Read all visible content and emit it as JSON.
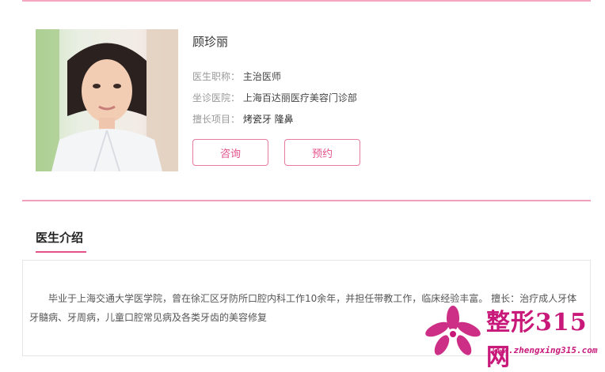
{
  "doctor": {
    "name": "顾珍丽",
    "title_label": "医生职称：",
    "title_value": "主治医师",
    "hospital_label": "坐诊医院：",
    "hospital_value": "上海百达丽医疗美容门诊部",
    "specialty_label": "擅长项目：",
    "specialty_value": "烤瓷牙 隆鼻"
  },
  "actions": {
    "consult_label": "咨询",
    "book_label": "预约"
  },
  "intro": {
    "title": "医生介绍",
    "text": "毕业于上海交通大学医学院，曾在徐汇区牙防所口腔内科工作10余年，并担任带教工作，临床经验丰富。 擅长：治疗成人牙体牙髓病、牙周病，儿童口腔常见病及各类牙齿的美容修复"
  },
  "watermark": {
    "brand": "整形315网",
    "url": "www.zhengxing315.com"
  },
  "colors": {
    "accent": "#e4528a",
    "divider": "#f29fbd",
    "watermark": "#c8197a"
  }
}
